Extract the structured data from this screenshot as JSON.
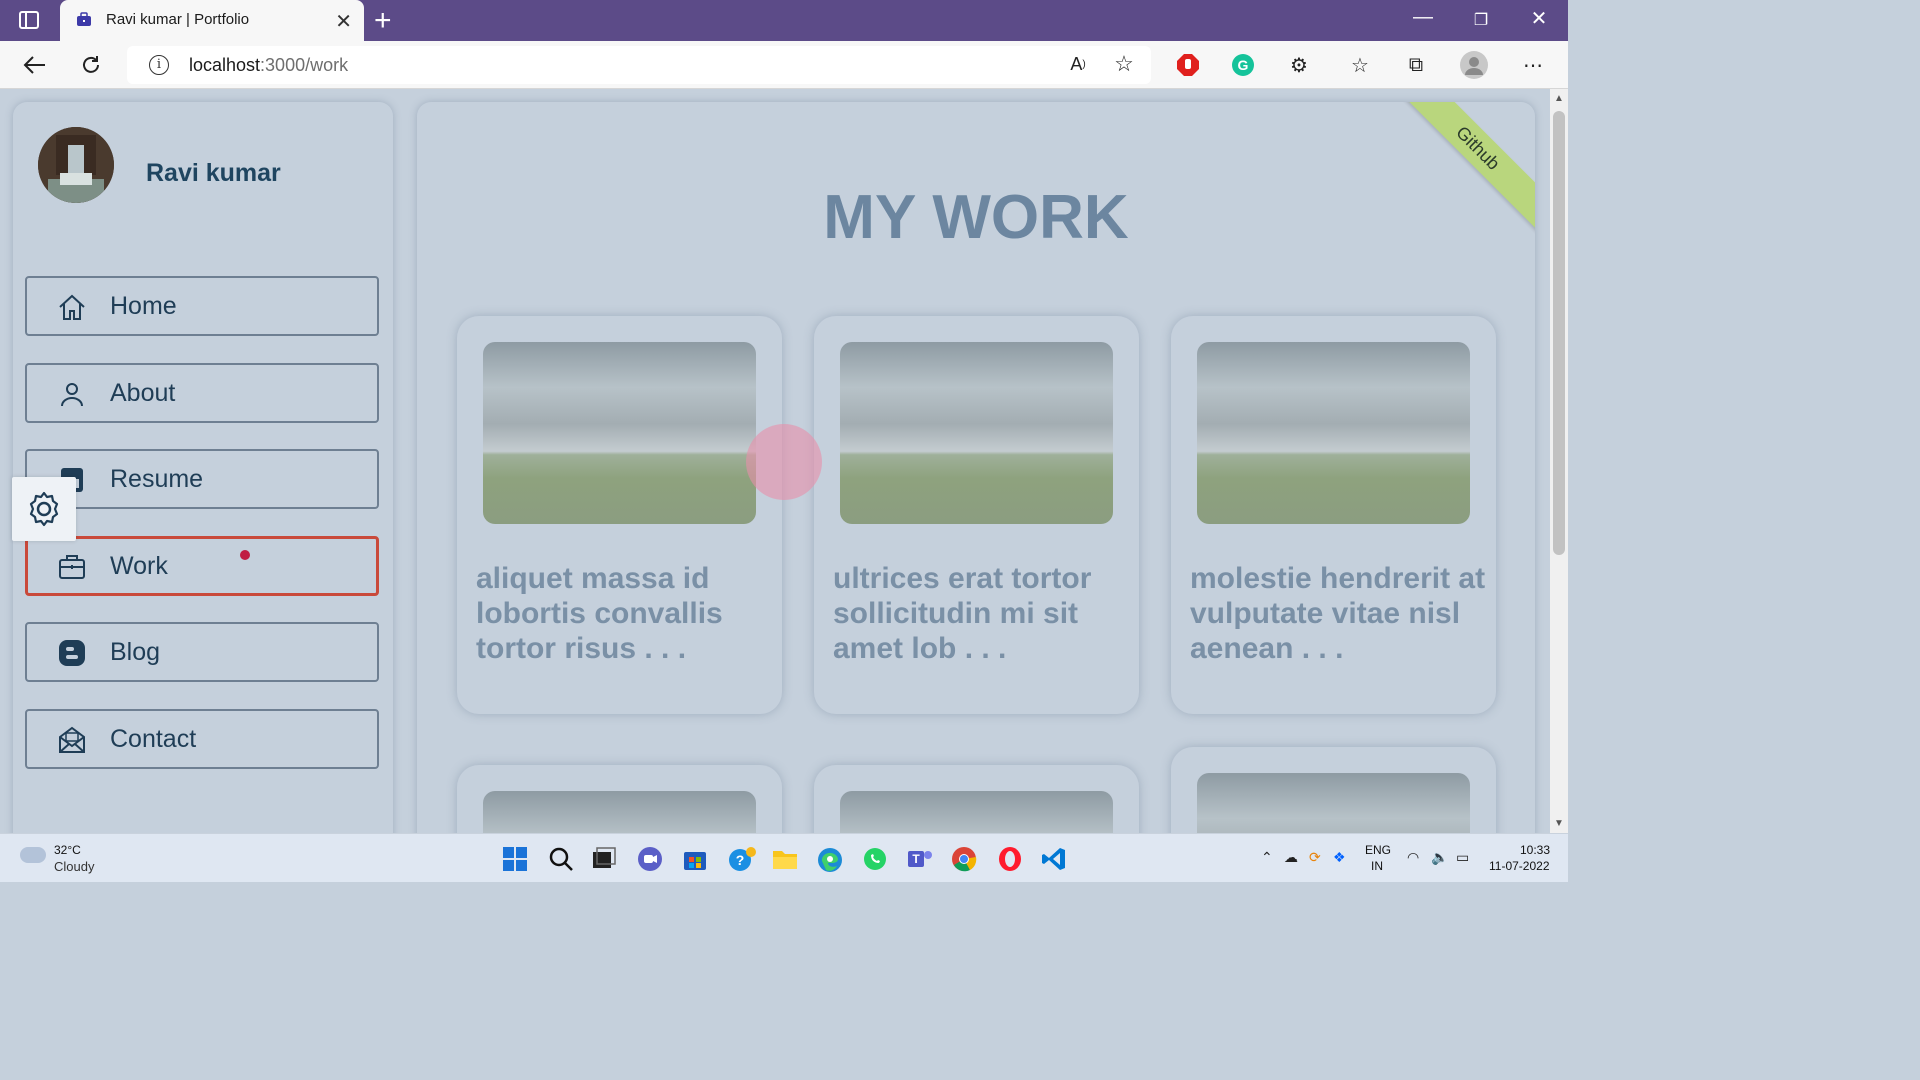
{
  "browser": {
    "tab_title": "Ravi kumar | Portfolio",
    "url_host": "localhost",
    "url_path": ":3000/work",
    "icons": [
      "tab-strip-icon",
      "close-icon",
      "new-tab-icon",
      "minimize-icon",
      "maximize-icon",
      "window-close-icon",
      "back-icon",
      "refresh-icon",
      "site-info-icon",
      "read-aloud-icon",
      "add-favorite-icon",
      "adblock-icon",
      "grammarly-icon",
      "extensions-icon",
      "favorites-icon",
      "collections-icon",
      "profile-icon",
      "more-icon"
    ]
  },
  "sidebar": {
    "name": "Ravi kumar",
    "nav": [
      {
        "label": "Home",
        "icon": "home-icon"
      },
      {
        "label": "About",
        "icon": "user-icon"
      },
      {
        "label": "Resume",
        "icon": "chart-icon"
      },
      {
        "label": "Work",
        "icon": "briefcase-icon",
        "active": true
      },
      {
        "label": "Blog",
        "icon": "blogger-icon"
      },
      {
        "label": "Contact",
        "icon": "envelope-open-icon"
      }
    ],
    "settings_icon": "gear-icon"
  },
  "main": {
    "ribbon": "Github",
    "heading": "MY WORK",
    "cards": [
      {
        "text": "aliquet massa id lobortis convallis tortor risus . . ."
      },
      {
        "text": "ultrices erat tortor sollicitudin mi sit amet lob . . ."
      },
      {
        "text": "molestie hendrerit at vulputate vitae nisl aenean . . ."
      }
    ]
  },
  "taskbar": {
    "temp": "32°C",
    "weather": "Cloudy",
    "lang_1": "ENG",
    "lang_2": "IN",
    "time": "10:33",
    "date": "11-07-2022"
  },
  "colors": {
    "titlebar": "#5c4b88",
    "page_bg": "#c5d0dc",
    "heading": "#6c86a0",
    "active_border": "#c9493a",
    "ribbon": "#b9d67d"
  }
}
